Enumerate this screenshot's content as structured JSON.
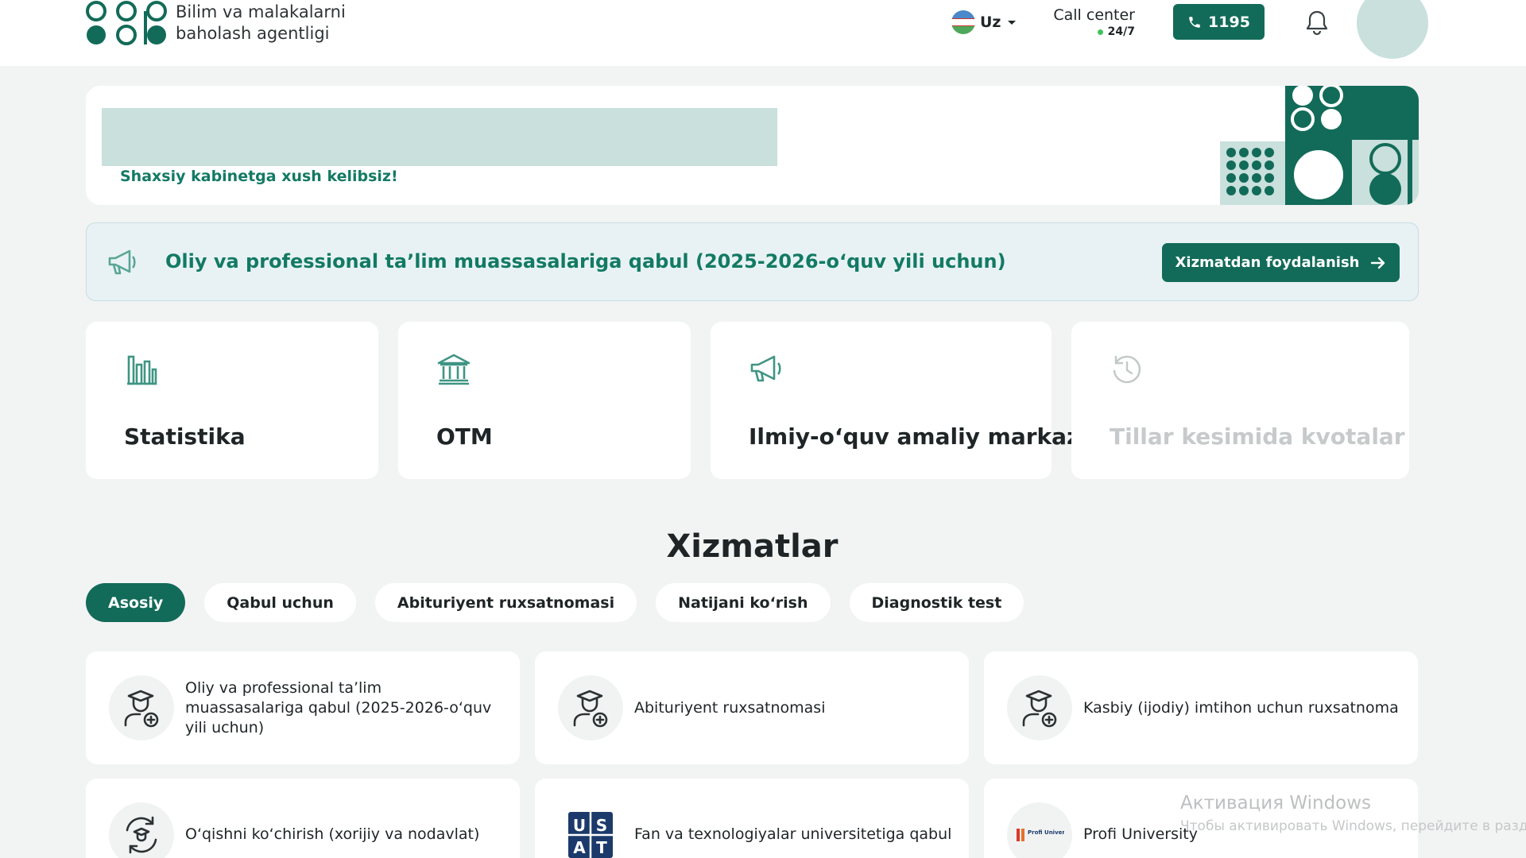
{
  "header": {
    "logo_text_line1": "Bilim va malakalarni",
    "logo_text_line2": "baholash agentligi",
    "language": "Uz",
    "call_center_title": "Call center",
    "call_center_hours": "24/7",
    "phone_number": "1195"
  },
  "welcome": {
    "greeting": "Shaxsiy kabinetga xush kelibsiz!"
  },
  "announcement": {
    "text": "Oliy va professional ta’lim muassasalariga qabul (2025-2026-o‘quv yili uchun)",
    "button_label": "Xizmatdan foydalanish"
  },
  "quick_links": [
    {
      "label": "Statistika",
      "icon": "bar-chart-icon",
      "enabled": true
    },
    {
      "label": "OTM",
      "icon": "university-building-icon",
      "enabled": true
    },
    {
      "label": "Ilmiy-o‘quv amaliy markazi",
      "icon": "megaphone-icon",
      "enabled": true
    },
    {
      "label": "Tillar kesimida kvotalar",
      "icon": "clock-history-icon",
      "enabled": false
    }
  ],
  "services_section": {
    "title": "Xizmatlar",
    "tabs": [
      {
        "label": "Asosiy",
        "active": true
      },
      {
        "label": "Qabul uchun",
        "active": false
      },
      {
        "label": "Abituriyent ruxsatnomasi",
        "active": false
      },
      {
        "label": "Natijani ko‘rish",
        "active": false
      },
      {
        "label": "Diagnostik test",
        "active": false
      }
    ],
    "cards": [
      {
        "label": "Oliy va professional ta’lim muassasalariga qabul (2025-2026-o‘quv yili uchun)",
        "icon": "graduate-add-icon"
      },
      {
        "label": "Abituriyent ruxsatnomasi",
        "icon": "graduate-add-icon"
      },
      {
        "label": "Kasbiy (ijodiy) imtihon uchun ruxsatnoma",
        "icon": "graduate-add-icon"
      },
      {
        "label": "O‘qishni ko‘chirish (xorijiy va nodavlat)",
        "icon": "graduate-transfer-icon"
      },
      {
        "label": "Fan va texnologiyalar universitetiga qabul",
        "icon": "usat-logo"
      },
      {
        "label": "Profi University",
        "icon": "profi-university-logo"
      }
    ],
    "usat_logo_letters": [
      "U",
      "S",
      "A",
      "T"
    ],
    "profi_logo_text": "Profi University"
  },
  "watermark": {
    "line1": "Активация Windows",
    "line2": "Чтобы активировать Windows, перейдите в раздел"
  },
  "colors": {
    "brand_green": "#126b58",
    "brand_text_green": "#137a64",
    "light_teal": "#c9e0dc",
    "background": "#f2f3f3"
  }
}
